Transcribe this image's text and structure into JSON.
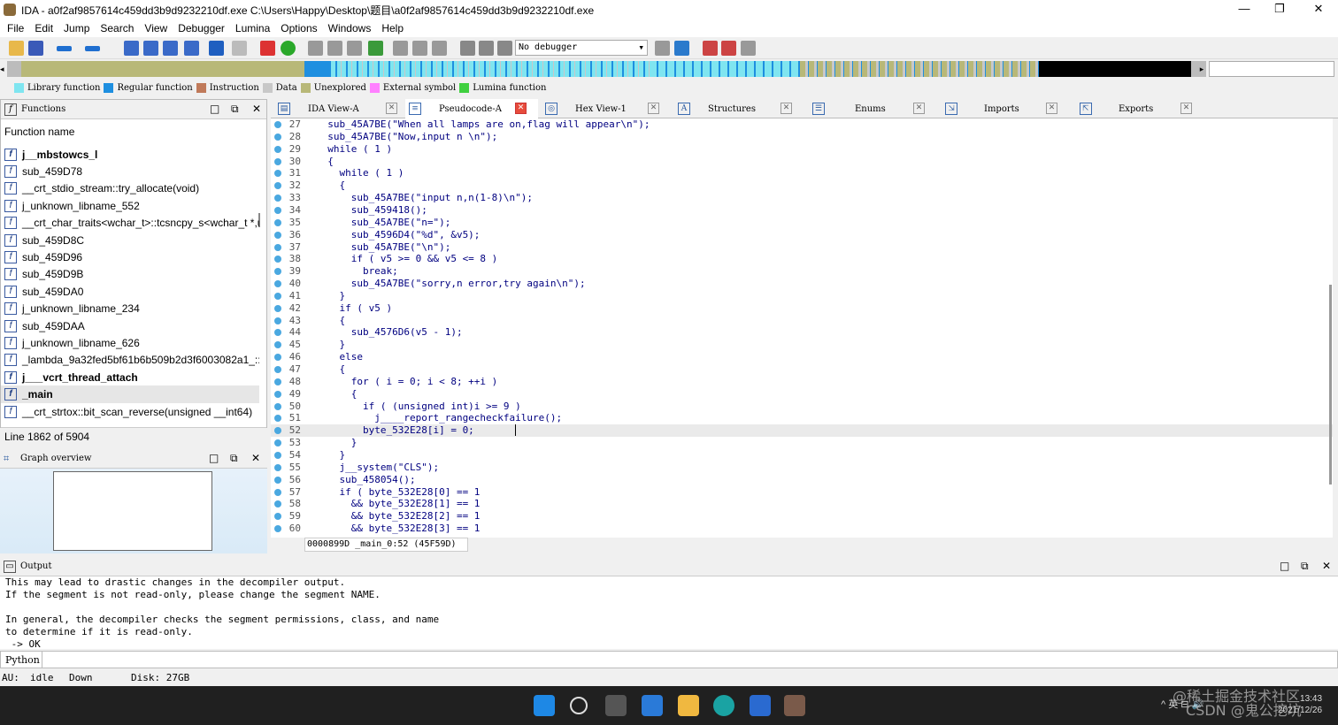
{
  "window": {
    "title": "IDA - a0f2af9857614c459dd3b9d9232210df.exe C:\\Users\\Happy\\Desktop\\题目\\a0f2af9857614c459dd3b9d9232210df.exe",
    "minimize": "—",
    "maximize": "❐",
    "close": "✕"
  },
  "menu": [
    "File",
    "Edit",
    "Jump",
    "Search",
    "View",
    "Debugger",
    "Lumina",
    "Options",
    "Windows",
    "Help"
  ],
  "debugger_select": "No debugger",
  "legend": [
    {
      "label": "Library function",
      "color": "#7fe5f0"
    },
    {
      "label": "Regular function",
      "color": "#1e8fe0"
    },
    {
      "label": "Instruction",
      "color": "#c07a5a"
    },
    {
      "label": "Data",
      "color": "#c8c8c8"
    },
    {
      "label": "Unexplored",
      "color": "#b8b878"
    },
    {
      "label": "External symbol",
      "color": "#ff80ff"
    },
    {
      "label": "Lumina function",
      "color": "#40d040"
    }
  ],
  "functions_panel": {
    "title": "Functions",
    "column": "Function name",
    "items": [
      {
        "name": "j__mbstowcs_l",
        "bold": true
      },
      {
        "name": "sub_459D78",
        "bold": false
      },
      {
        "name": "__crt_stdio_stream::try_allocate(void)",
        "bold": false
      },
      {
        "name": "j_unknown_libname_552",
        "bold": false
      },
      {
        "name": "__crt_char_traits<wchar_t>::tcsncpy_s<wchar_t *,ui",
        "bold": false
      },
      {
        "name": "sub_459D8C",
        "bold": false
      },
      {
        "name": "sub_459D96",
        "bold": false
      },
      {
        "name": "sub_459D9B",
        "bold": false
      },
      {
        "name": "sub_459DA0",
        "bold": false
      },
      {
        "name": "j_unknown_libname_234",
        "bold": false
      },
      {
        "name": "sub_459DAA",
        "bold": false
      },
      {
        "name": "j_unknown_libname_626",
        "bold": false
      },
      {
        "name": "_lambda_9a32fed5bf61b6b509b2d3f6003082a1_::",
        "bold": false
      },
      {
        "name": "j___vcrt_thread_attach",
        "bold": true
      },
      {
        "name": "_main",
        "bold": true
      },
      {
        "name": "__crt_strtox::bit_scan_reverse(unsigned __int64)",
        "bold": false
      }
    ],
    "status": "Line 1862 of 5904"
  },
  "graph_panel": {
    "title": "Graph overview"
  },
  "tabs": [
    {
      "label": "IDA View-A",
      "active": false
    },
    {
      "label": "Pseudocode-A",
      "active": true
    },
    {
      "label": "Hex View-1",
      "active": false
    },
    {
      "label": "Structures",
      "active": false
    },
    {
      "label": "Enums",
      "active": false
    },
    {
      "label": "Imports",
      "active": false
    },
    {
      "label": "Exports",
      "active": false
    }
  ],
  "code": [
    {
      "n": "27",
      "t": "  sub_45A7BE(\"When all lamps are on,flag will appear\\n\");"
    },
    {
      "n": "28",
      "t": "  sub_45A7BE(\"Now,input n \\n\");"
    },
    {
      "n": "29",
      "t": "  while ( 1 )"
    },
    {
      "n": "30",
      "t": "  {"
    },
    {
      "n": "31",
      "t": "    while ( 1 )"
    },
    {
      "n": "32",
      "t": "    {"
    },
    {
      "n": "33",
      "t": "      sub_45A7BE(\"input n,n(1-8)\\n\");"
    },
    {
      "n": "34",
      "t": "      sub_459418();"
    },
    {
      "n": "35",
      "t": "      sub_45A7BE(\"n=\");"
    },
    {
      "n": "36",
      "t": "      sub_4596D4(\"%d\", &v5);"
    },
    {
      "n": "37",
      "t": "      sub_45A7BE(\"\\n\");"
    },
    {
      "n": "38",
      "t": "      if ( v5 >= 0 && v5 <= 8 )"
    },
    {
      "n": "39",
      "t": "        break;"
    },
    {
      "n": "40",
      "t": "      sub_45A7BE(\"sorry,n error,try again\\n\");"
    },
    {
      "n": "41",
      "t": "    }"
    },
    {
      "n": "42",
      "t": "    if ( v5 )"
    },
    {
      "n": "43",
      "t": "    {"
    },
    {
      "n": "44",
      "t": "      sub_4576D6(v5 - 1);"
    },
    {
      "n": "45",
      "t": "    }"
    },
    {
      "n": "46",
      "t": "    else"
    },
    {
      "n": "47",
      "t": "    {"
    },
    {
      "n": "48",
      "t": "      for ( i = 0; i < 8; ++i )"
    },
    {
      "n": "49",
      "t": "      {"
    },
    {
      "n": "50",
      "t": "        if ( (unsigned int)i >= 9 )"
    },
    {
      "n": "51",
      "t": "          j____report_rangecheckfailure();"
    },
    {
      "n": "52",
      "t": "        byte_532E28[i] = 0;"
    },
    {
      "n": "53",
      "t": "      }"
    },
    {
      "n": "54",
      "t": "    }"
    },
    {
      "n": "55",
      "t": "    j__system(\"CLS\");"
    },
    {
      "n": "56",
      "t": "    sub_458054();"
    },
    {
      "n": "57",
      "t": "    if ( byte_532E28[0] == 1"
    },
    {
      "n": "58",
      "t": "      && byte_532E28[1] == 1"
    },
    {
      "n": "59",
      "t": "      && byte_532E28[2] == 1"
    },
    {
      "n": "60",
      "t": "      && byte_532E28[3] == 1"
    }
  ],
  "code_status": "0000899D _main_0:52 (45F59D)",
  "output_panel": {
    "title": "Output",
    "lines": [
      "This may lead to drastic changes in the decompiler output.",
      "If the segment is not read-only, please change the segment NAME.",
      "",
      "In general, the decompiler checks the segment permissions, class, and name",
      "to determine if it is read-only.",
      " -> OK"
    ]
  },
  "python_label": "Python",
  "statusbar": {
    "au_label": "AU:",
    "au_state": "idle",
    "dir": "Down",
    "disk": "Disk: 27GB"
  },
  "taskbar": {
    "tray": "^  英  ⊟  🔊",
    "time": "13:43",
    "date": "2021/12/26"
  },
  "watermark": [
    "@稀土掘金技术社区",
    "CSDN @鬼公挖坑"
  ]
}
